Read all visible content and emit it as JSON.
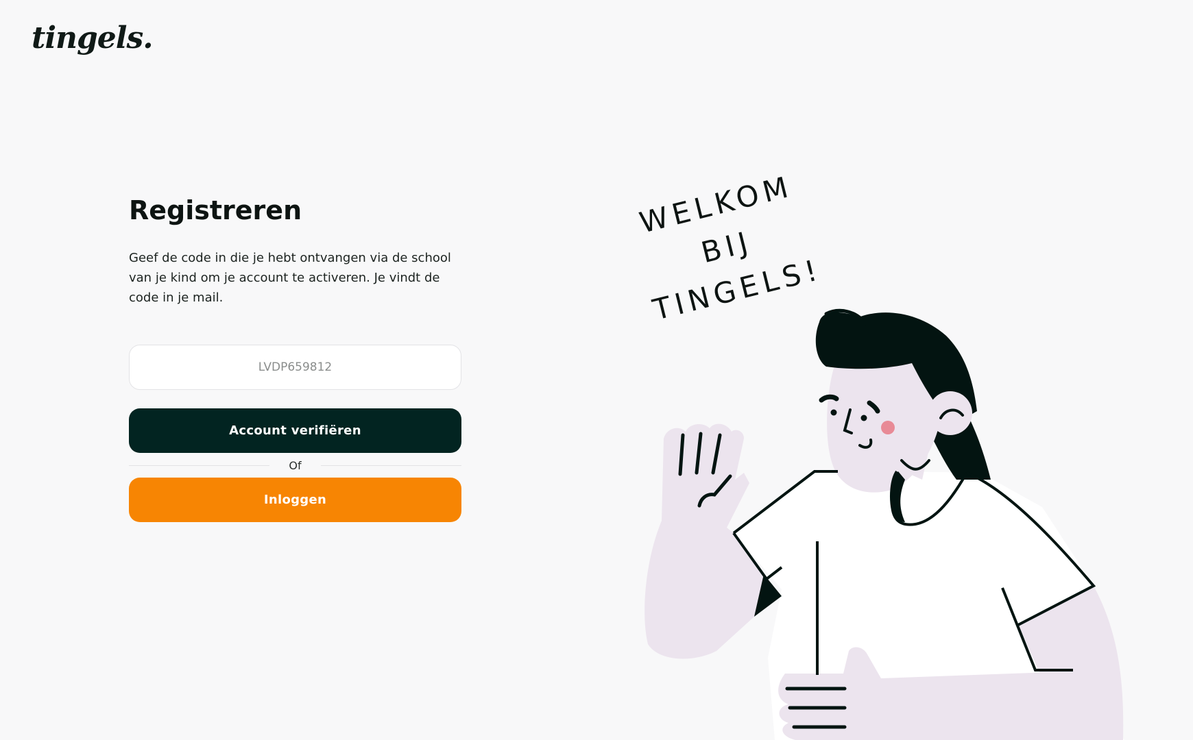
{
  "brand": {
    "logo_text": "tingels."
  },
  "form": {
    "title": "Registreren",
    "description": "Geef de code in die je hebt ontvangen via de school van je kind om je account te activeren. Je vindt de code in je mail.",
    "code_placeholder": "LVDP659812",
    "code_value": "",
    "verify_button_label": "Account verifiëren",
    "divider_label": "Of",
    "login_button_label": "Inloggen"
  },
  "illustration": {
    "welcome_line1": "WELKOM BIJ",
    "welcome_line2": "TINGELS!"
  },
  "colors": {
    "background": "#f8f8f9",
    "verify_button": "#022421",
    "login_button": "#f78503",
    "skin": "#ece4ee",
    "hair": "#031411",
    "cheek": "#e88a96"
  }
}
